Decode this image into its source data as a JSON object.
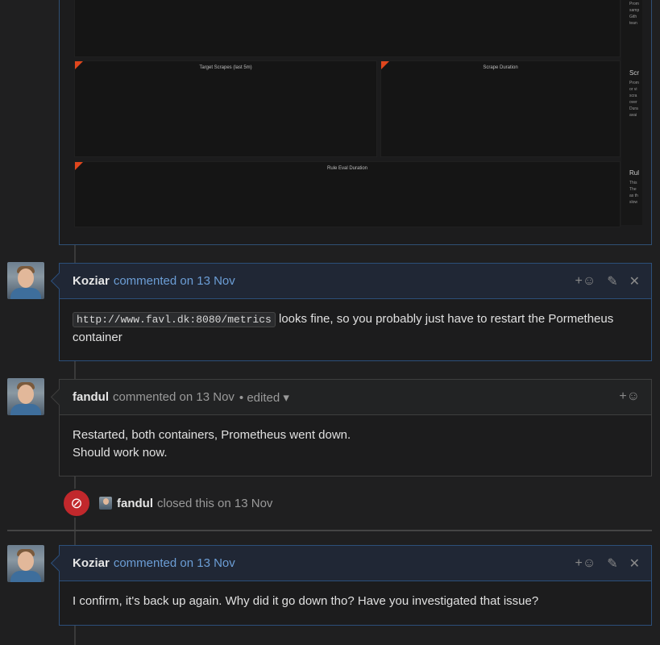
{
  "dashboard": {
    "panels": [
      {
        "title": "Target Scrapes (last 5m)"
      },
      {
        "title": "Scrape Duration"
      },
      {
        "title": "Rule Eval Duration"
      }
    ],
    "side_top": [
      "Prom",
      "samp",
      "Gith",
      "tean"
    ],
    "side_sections": [
      {
        "heading": "Scr",
        "lines": [
          "Prom",
          "or vi",
          "scra",
          "over",
          "Dura",
          "avai"
        ]
      },
      {
        "heading": "Rul",
        "lines": [
          "This",
          "The",
          "as th",
          "slow"
        ]
      }
    ]
  },
  "comments": [
    {
      "author": "Koziar",
      "meta": "commented on 13 Nov",
      "code": "http://www.favl.dk:8080/metrics",
      "text": " looks fine, so you probably just have to restart the Pormetheus container",
      "icons": [
        "add-reaction-icon",
        "edit-icon",
        "delete-icon"
      ]
    },
    {
      "author": "fandul",
      "meta": "commented on 13 Nov",
      "edited": "• edited ▾",
      "lines": [
        "Restarted, both containers, Prometheus went down.",
        "Should work now."
      ],
      "icons": [
        "add-reaction-icon"
      ]
    },
    {
      "author": "Koziar",
      "meta": "commented on 13 Nov",
      "text": "I confirm, it's back up again. Why did it go down tho? Have you investigated that issue?",
      "icons": [
        "add-reaction-icon",
        "edit-icon",
        "delete-icon"
      ]
    }
  ],
  "event": {
    "actor": "fandul",
    "text": "closed this on 13 Nov",
    "icon": "closed-icon",
    "color": "#c1282c"
  },
  "colors": {
    "background": "#1f1f20",
    "self_border": "#2c4f7a",
    "link_meta": "#6c9ed6",
    "panel_corner": "#e0461d"
  }
}
